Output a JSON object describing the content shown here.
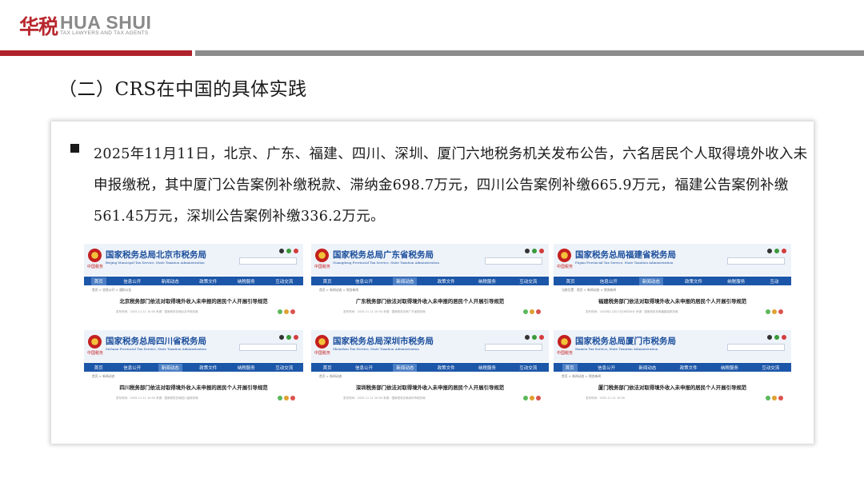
{
  "logo": {
    "cn": "华税",
    "en": "HUA SHUI",
    "en_sub": "TAX LAWYERS AND TAX AGENTS"
  },
  "slide_title": "（二）CRS在中国的具体实践",
  "body_text": "2025年11月11日，北京、广东、福建、四川、深圳、厦门六地税务机关发布公告，六名居民个人取得境外收入未申报缴税，其中厦门公告案例补缴税款、滞纳金698.7万元，四川公告案例补缴665.9万元，福建公告案例补缴561.45万元，深圳公告案例补缴336.2万元。",
  "screenshots": [
    {
      "site_title": "国家税务总局北京市税务局",
      "site_sub": "Beijing Municipal Tax Service, State Taxation Administration",
      "emblem_sub": "中国税务",
      "nav": [
        "首页",
        "信息公开",
        "新闻动态",
        "政策文件",
        "纳税服务",
        "互动交流"
      ],
      "active_nav": 0,
      "crumb": "首页 > 信息公开 > 通知公告",
      "article_title": "北京税务部门依法对取得境外收入未申报的居民个人开展引导规范",
      "meta": "发布时间：2025-11-11 10:00  来源：国家税务总局北京市税务局"
    },
    {
      "site_title": "国家税务总局广东省税务局",
      "site_sub": "Guangdong Provincial Tax Service, State Taxation Administration",
      "emblem_sub": "中国税务",
      "nav": [
        "首页",
        "信息公开",
        "新闻动态",
        "政策文件",
        "纳税服务",
        "互动交流"
      ],
      "active_nav": 2,
      "crumb": "首页 > 新闻动态 > 税务新闻",
      "article_title": "广东税务部门依法对取得境外收入未申报的居民个人开展引导规范",
      "meta": "发布时间：2025-11-11 10:00  来源：国家税务总局广东省税务局"
    },
    {
      "site_title": "国家税务总局福建省税务局",
      "site_sub": "Fujian Provincial Tax Service, State Taxation Administration",
      "emblem_sub": "中国税务",
      "nav": [
        "首页",
        "信息公开",
        "新闻动态",
        "政策文件",
        "纳税服务",
        "互动"
      ],
      "active_nav": 2,
      "crumb": "当前位置：首页 > 新闻动态 > 税务新闻",
      "article_title": "福建税务部门依法对取得境外收入未申报的居民个人开展引导规范",
      "meta": "发布时间：2025年11月11日18时00分  来源：国家税务总局福建省税务局"
    },
    {
      "site_title": "国家税务总局四川省税务局",
      "site_sub": "Sichuan Provincial Tax Service, State Taxation Administration",
      "emblem_sub": "中国税务",
      "nav": [
        "首页",
        "信息公开",
        "新闻动态",
        "政策文件",
        "纳税服务",
        "互动交流"
      ],
      "active_nav": 2,
      "crumb": "首页 > 新闻动态",
      "article_title": "四川税务部门依法对取得境外收入未申报的居民个人开展引导规范",
      "meta": "发布时间：2025-11-11 10:00  来源：国家税务总局四川省税务局"
    },
    {
      "site_title": "国家税务总局深圳市税务局",
      "site_sub": "Shenzhen Tax Service, State Taxation Administration",
      "emblem_sub": "中国税务",
      "nav": [
        "首页",
        "信息公开",
        "新闻动态",
        "政策文件",
        "纳税服务",
        "互动交流"
      ],
      "active_nav": 2,
      "crumb": "首页 > 新闻动态",
      "article_title": "深圳税务部门依法对取得境外收入未申报的居民个人开展引导规范",
      "meta": "发布时间：2025-11-11 10:00  来源：国家税务总局深圳市税务局"
    },
    {
      "site_title": "国家税务总局厦门市税务局",
      "site_sub": "Xiamen Tax Service, State Taxation Administration",
      "emblem_sub": "中国税务",
      "nav": [
        "首页",
        "信息公开",
        "新闻动态",
        "政策文件",
        "纳税服务",
        "互动交流"
      ],
      "active_nav": 0,
      "crumb": "首页 > 新闻动态 > 税务新闻",
      "article_title": "厦门税务部门依法对取得境外收入未申报的居民个人开展引导规范",
      "meta": "发布时间：2025-11-11 10:00"
    }
  ],
  "colors": {
    "brand_red": "#b0222b",
    "rule_gray": "#8c8c8c",
    "site_blue": "#1c56a8"
  }
}
